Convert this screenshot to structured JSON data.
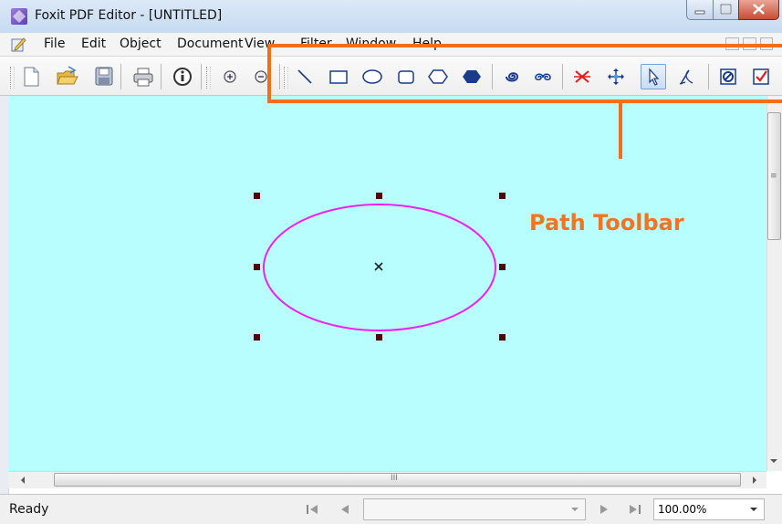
{
  "window": {
    "title": "Foxit PDF Editor - [UNTITLED]"
  },
  "menu": {
    "items": [
      "File",
      "Edit",
      "Object",
      "Document",
      "View",
      "Filter",
      "Window",
      "Help"
    ]
  },
  "toolbar": {
    "file_tools": [
      "new-document",
      "open-folder",
      "save",
      "print",
      "info"
    ],
    "zoom_tools": [
      "zoom-in",
      "zoom-out"
    ],
    "path_tools": [
      "line",
      "rectangle",
      "ellipse",
      "rounded-rectangle",
      "polygon",
      "filled-shape",
      "spiral",
      "double-spiral",
      "delete-point",
      "move",
      "select-arrow",
      "bezier-edit",
      "stop",
      "check"
    ],
    "active_tool": "select-arrow"
  },
  "canvas": {
    "background": "#b9feff",
    "shape": "ellipse",
    "shape_color": "#ee22ee",
    "selected": true
  },
  "annotation": {
    "label": "Path Toolbar",
    "color": "#f26e1c"
  },
  "status": {
    "text": "Ready",
    "page": "",
    "zoom": "100.00%"
  },
  "scrollbar": {
    "h_grip": "III",
    "v_grip": "≡"
  }
}
